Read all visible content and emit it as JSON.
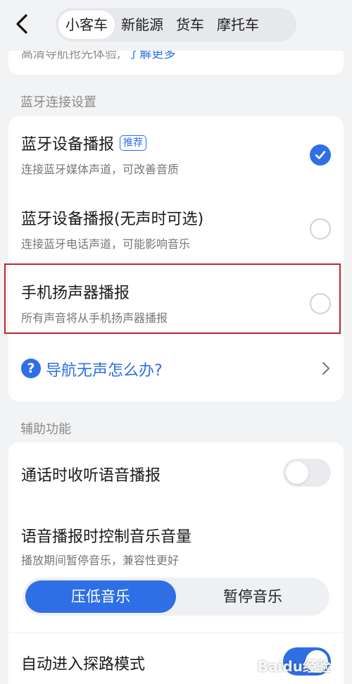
{
  "header": {
    "tabs": [
      {
        "label": "小客车",
        "active": true
      },
      {
        "label": "新能源",
        "active": false
      },
      {
        "label": "货车",
        "active": false
      },
      {
        "label": "摩托车",
        "active": false
      }
    ]
  },
  "top_card": {
    "partial_text": "高清导航抢先体验,",
    "link_text": "了解更多"
  },
  "bluetooth": {
    "section_title": "蓝牙连接设置",
    "options": [
      {
        "title": "蓝牙设备播报",
        "badge": "推荐",
        "subtitle": "连接蓝牙媒体声道，可改善音质",
        "checked": true
      },
      {
        "title": "蓝牙设备播报(无声时可选)",
        "subtitle": "连接蓝牙电话声道，可能影响音乐",
        "checked": false
      },
      {
        "title": "手机扬声器播报",
        "subtitle": "所有声音将从手机扬声器播报",
        "checked": false
      }
    ],
    "help_link": "导航无声怎么办?"
  },
  "assist": {
    "section_title": "辅助功能",
    "call_broadcast": {
      "title": "通话时收听语音播报",
      "enabled": false
    },
    "music_control": {
      "title": "语音播报时控制音乐音量",
      "subtitle": "播放期间暂停音乐，兼容性更好",
      "options": [
        "压低音乐",
        "暂停音乐"
      ],
      "selected": "压低音乐"
    },
    "explore_mode": {
      "title": "自动进入探路模式",
      "enabled": true
    }
  },
  "colors": {
    "accent": "#2f6fe6",
    "highlight_box": "#c0262b",
    "background": "#f2f3f5"
  },
  "watermark": "Baidu经验"
}
